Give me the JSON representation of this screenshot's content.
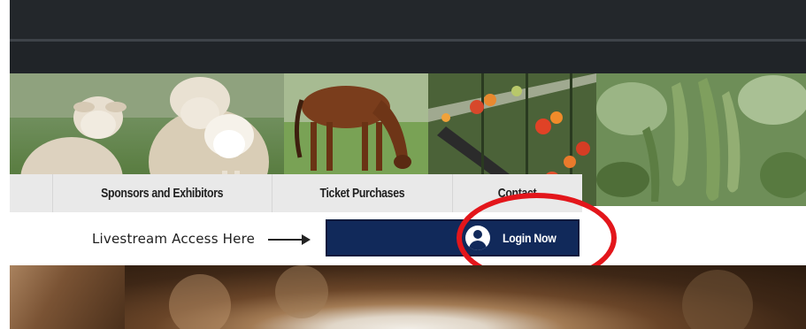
{
  "nav": {
    "items": [
      {
        "label": ""
      },
      {
        "label": "Sponsors and Exhibitors"
      },
      {
        "label": "Ticket Purchases"
      },
      {
        "label": "Contact"
      }
    ]
  },
  "livestream": {
    "label": "Livestream Access Here"
  },
  "login": {
    "label": "Login Now",
    "icon": "user-avatar-icon"
  },
  "colors": {
    "top_bar": "#23272b",
    "nav_background": "#e9e9e9",
    "login_button": "#11295a",
    "highlight_ring": "#e3161b"
  }
}
